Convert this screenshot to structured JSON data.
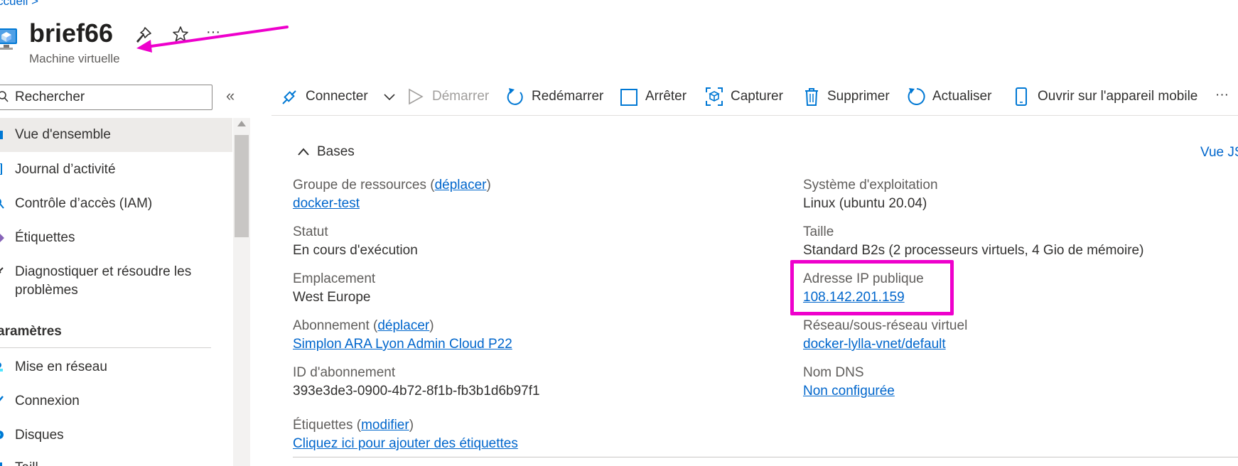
{
  "breadcrumb": {
    "text": "ccueil  >"
  },
  "header": {
    "title": "brief66",
    "subtitle": "Machine virtuelle",
    "pin_icon": "pin-icon",
    "star_icon": "star-icon",
    "more_label": "···"
  },
  "annotation": {
    "arrow_color": "#ee00cc",
    "box_color": "#ee00cc"
  },
  "search": {
    "placeholder": "Rechercher",
    "collapse_label": "«"
  },
  "sidebar": {
    "items": [
      {
        "label": "Vue d'ensemble",
        "icon": "overview-icon",
        "active": true
      },
      {
        "label": "Journal d’activité",
        "icon": "activity-log-icon"
      },
      {
        "label": "Contrôle d’accès (IAM)",
        "icon": "iam-icon"
      },
      {
        "label": "Étiquettes",
        "icon": "tags-icon"
      },
      {
        "label": "Diagnostiquer et résoudre les",
        "label2": "problèmes",
        "icon": "diagnose-icon"
      }
    ],
    "section_title": "aramètres",
    "settings_items": [
      {
        "label": "Mise en réseau",
        "icon": "networking-icon"
      },
      {
        "label": "Connexion",
        "icon": "connect-icon"
      },
      {
        "label": "Disques",
        "icon": "disks-icon"
      },
      {
        "label": "Taill",
        "icon": "size-icon"
      }
    ]
  },
  "toolbar": {
    "connect": "Connecter",
    "start": "Démarrer",
    "restart": "Redémarrer",
    "stop": "Arrêter",
    "capture": "Capturer",
    "delete": "Supprimer",
    "refresh": "Actualiser",
    "mobile": "Ouvrir sur l'appareil mobile",
    "more": "···"
  },
  "essentials": {
    "toggle_label": "Bases",
    "json_view": "Vue JS",
    "left": {
      "resource_group_label": "Groupe de ressources (",
      "resource_group_move": "déplacer",
      "resource_group_close": ")",
      "resource_group_value": "docker-test",
      "status_label": "Statut",
      "status_value": "En cours d'exécution",
      "location_label": "Emplacement",
      "location_value": "West Europe",
      "subscription_label": "Abonnement (",
      "subscription_move": "déplacer",
      "subscription_close": ")",
      "subscription_value": "Simplon ARA Lyon Admin Cloud P22",
      "subscription_id_label": "ID d'abonnement",
      "subscription_id_value": "393e3de3-0900-4b72-8f1b-fb3b1d6b97f1",
      "tags_label": "Étiquettes (",
      "tags_modify": "modifier",
      "tags_close": ")",
      "tags_value": "Cliquez ici pour ajouter des étiquettes"
    },
    "right": {
      "os_label": "Système d'exploitation",
      "os_value": "Linux (ubuntu 20.04)",
      "size_label": "Taille",
      "size_value": "Standard B2s (2 processeurs virtuels, 4 Gio de mémoire)",
      "public_ip_label": "Adresse IP publique",
      "public_ip_value": "108.142.201.159",
      "vnet_label": "Réseau/sous-réseau virtuel",
      "vnet_value": "docker-lylla-vnet/default",
      "dns_label": "Nom DNS",
      "dns_value": "Non configurée"
    }
  },
  "colors": {
    "accent": "#0066cc",
    "highlight": "#ee00cc",
    "active_bg": "#edebe9"
  }
}
